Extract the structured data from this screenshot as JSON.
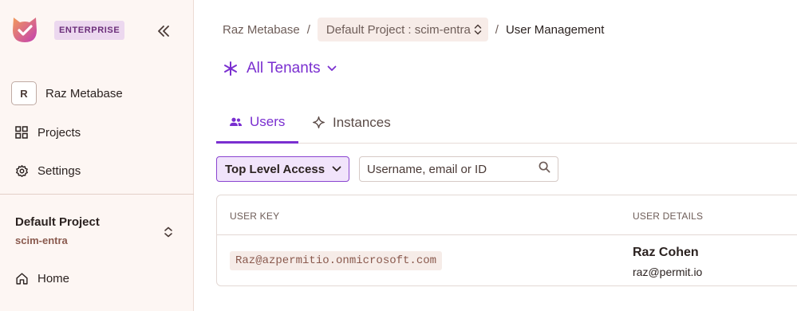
{
  "sidebar": {
    "badge": "ENTERPRISE",
    "org": {
      "avatar_letter": "R",
      "name": "Raz Metabase"
    },
    "nav": [
      {
        "label": "Projects",
        "icon": "grid-icon"
      },
      {
        "label": "Settings",
        "icon": "gear-icon"
      },
      {
        "label": "Home",
        "icon": "home-icon"
      }
    ],
    "project": {
      "name": "Default Project",
      "environment": "scim-entra"
    }
  },
  "breadcrumb": {
    "org": "Raz Metabase",
    "separator": "/",
    "project_env": "Default Project : scim-entra",
    "current": "User Management"
  },
  "tenant_selector": {
    "label": "All Tenants"
  },
  "tabs": [
    {
      "label": "Users",
      "active": true
    },
    {
      "label": "Instances",
      "active": false
    }
  ],
  "filter": {
    "label": "Top Level Access"
  },
  "search": {
    "placeholder": "Username, email or ID",
    "value": ""
  },
  "table": {
    "columns": [
      "USER KEY",
      "USER DETAILS"
    ],
    "rows": [
      {
        "key": "Raz@azpermitio.onmicrosoft.com",
        "name": "Raz Cohen",
        "email": "raz@permit.io"
      }
    ]
  },
  "colors": {
    "accent": "#7a2fd0",
    "sidebar_bg": "#fdf6f3",
    "badge_bg": "#ecd8ef"
  }
}
